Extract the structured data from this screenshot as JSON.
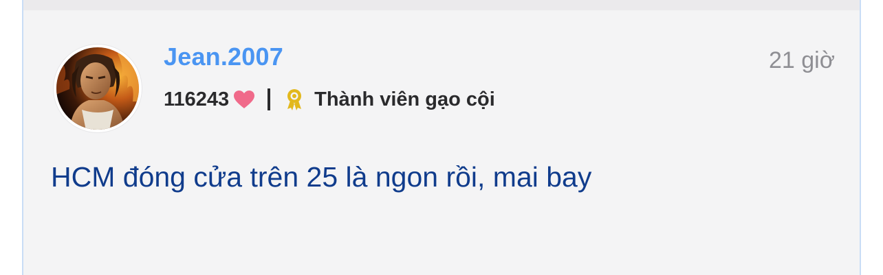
{
  "post": {
    "author": {
      "username": "Jean.2007",
      "points": "116243",
      "rank": "Thành viên gạo cội"
    },
    "timestamp": "21 giờ",
    "content": "HCM đóng cửa trên 25 là ngon rồi, mai bay"
  },
  "icons": {
    "points_icon": "heart-icon",
    "rank_icon": "award-ribbon-icon"
  },
  "colors": {
    "username": "#4a95f2",
    "content": "#103c8c",
    "heart": "#f06a8a",
    "badge": "#e2b81d",
    "card_background": "#f4f4f5",
    "card_border": "#c9ddf6"
  }
}
